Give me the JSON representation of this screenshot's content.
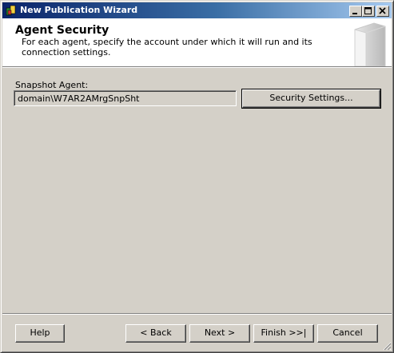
{
  "window": {
    "title": "New Publication Wizard"
  },
  "header": {
    "title": "Agent Security",
    "description": "For each agent, specify the account under which it will run and its connection settings."
  },
  "snapshot_agent": {
    "label": "Snapshot Agent:",
    "value": "domain\\W7AR2AMrgSnpSht",
    "security_button": "Security Settings..."
  },
  "footer": {
    "help": "Help",
    "back": "< Back",
    "next": "Next >",
    "finish": "Finish >>|",
    "cancel": "Cancel"
  },
  "icons": {
    "app": "wizard-app-icon",
    "minimize": "minimize-icon",
    "maximize": "maximize-icon",
    "close": "close-icon",
    "header_art": "document-art-icon",
    "grip": "resize-grip-icon"
  }
}
